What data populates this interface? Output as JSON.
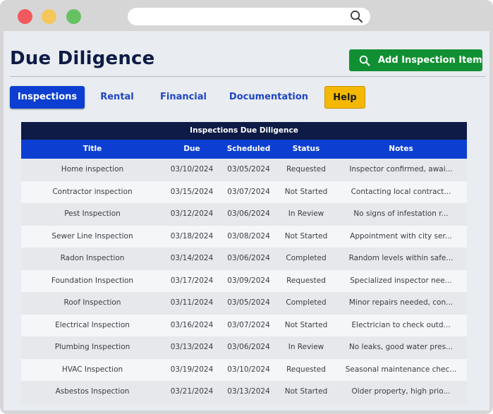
{
  "browser": {
    "search_icon": "search-icon"
  },
  "page": {
    "title": "Due Diligence",
    "add_button": "Add Inspection Item"
  },
  "tabs": [
    {
      "label": "Inspections",
      "active": true
    },
    {
      "label": "Rental",
      "active": false
    },
    {
      "label": "Financial",
      "active": false
    },
    {
      "label": "Documentation",
      "active": false
    },
    {
      "label": "Help",
      "active": false
    }
  ],
  "table": {
    "caption": "Inspections Due Diligence",
    "columns": [
      "Title",
      "Due",
      "Scheduled",
      "Status",
      "Notes"
    ],
    "rows": [
      {
        "title": "Home inspection",
        "due": "03/10/2024",
        "scheduled": "03/05/2024",
        "status": "Requested",
        "notes": "Inspector confirmed, awai..."
      },
      {
        "title": "Contractor inspection",
        "due": "03/15/2024",
        "scheduled": "03/07/2024",
        "status": "Not Started",
        "notes": "Contacting local contract..."
      },
      {
        "title": "Pest Inspection",
        "due": "03/12/2024",
        "scheduled": "03/06/2024",
        "status": "In Review",
        "notes": "No signs of infestation r..."
      },
      {
        "title": "Sewer Line Inspection",
        "due": "03/18/2024",
        "scheduled": "03/08/2024",
        "status": "Not Started",
        "notes": "Appointment with city ser..."
      },
      {
        "title": "Radon Inspection",
        "due": "03/14/2024",
        "scheduled": "03/06/2024",
        "status": "Completed",
        "notes": "Random levels within safe..."
      },
      {
        "title": "Foundation Inspection",
        "due": "03/17/2024",
        "scheduled": "03/09/2024",
        "status": "Requested",
        "notes": "Specialized inspector nee..."
      },
      {
        "title": "Roof Inspection",
        "due": "03/11/2024",
        "scheduled": "03/05/2024",
        "status": "Completed",
        "notes": "Minor repairs needed, con..."
      },
      {
        "title": "Electrical Inspection",
        "due": "03/16/2024",
        "scheduled": "03/07/2024",
        "status": "Not Started",
        "notes": "Electrician to check outd..."
      },
      {
        "title": "Plumbing Inspection",
        "due": "03/13/2024",
        "scheduled": "03/06/2024",
        "status": "In Review",
        "notes": "No leaks, good water pres..."
      },
      {
        "title": "HVAC Inspection",
        "due": "03/19/2024",
        "scheduled": "03/10/2024",
        "status": "Requested",
        "notes": "Seasonal maintenance chec..."
      },
      {
        "title": "Asbestos Inspection",
        "due": "03/21/2024",
        "scheduled": "03/13/2024",
        "status": "Not Started",
        "notes": "Older property, high prio..."
      }
    ]
  },
  "colors": {
    "title": "#0e1b46",
    "primary": "#0c3fd1",
    "add_button": "#119033",
    "help_button": "#f4b800"
  }
}
